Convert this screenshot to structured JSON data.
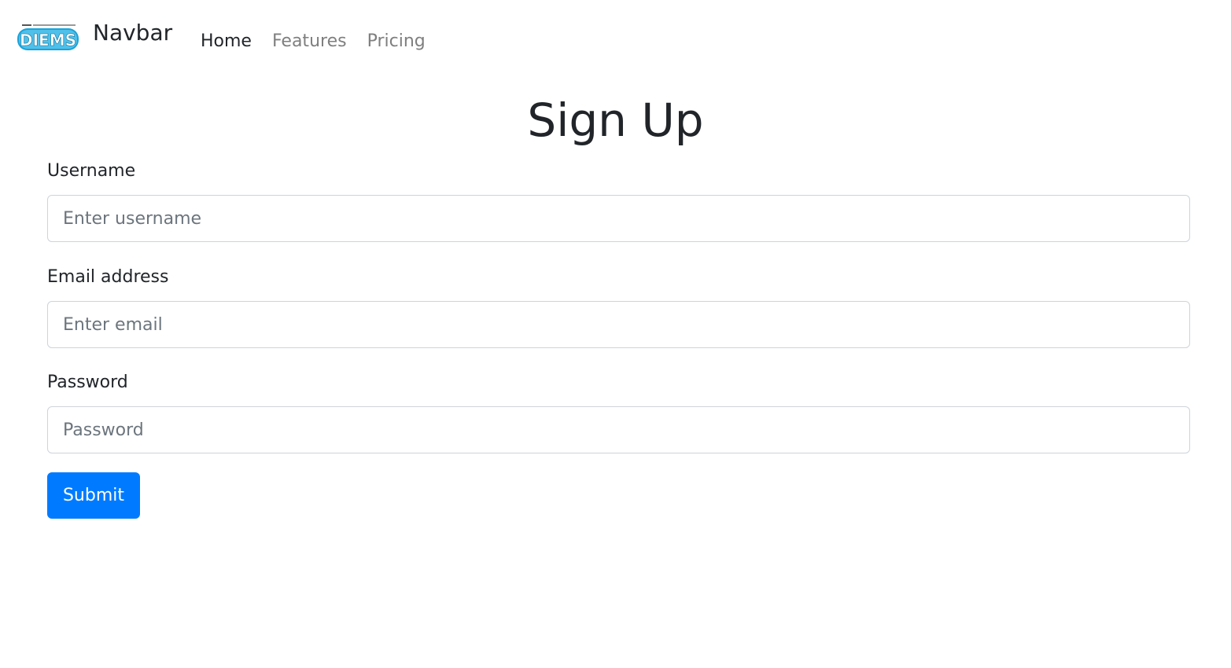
{
  "navbar": {
    "brand": {
      "logo_text": "DIEMS",
      "name": "Navbar"
    },
    "links": [
      {
        "label": "Home",
        "active": true
      },
      {
        "label": "Features",
        "active": false
      },
      {
        "label": "Pricing",
        "active": false
      }
    ]
  },
  "page": {
    "title": "Sign Up"
  },
  "form": {
    "username": {
      "label": "Username",
      "placeholder": "Enter username",
      "value": ""
    },
    "email": {
      "label": "Email address",
      "placeholder": "Enter email",
      "value": ""
    },
    "password": {
      "label": "Password",
      "placeholder": "Password",
      "value": ""
    },
    "submit_label": "Submit"
  },
  "colors": {
    "primary": "#007bff",
    "text": "#212529",
    "muted_link": "#7f7f7f",
    "input_border": "#ced4da",
    "logo_blue": "#1aa3d9"
  }
}
